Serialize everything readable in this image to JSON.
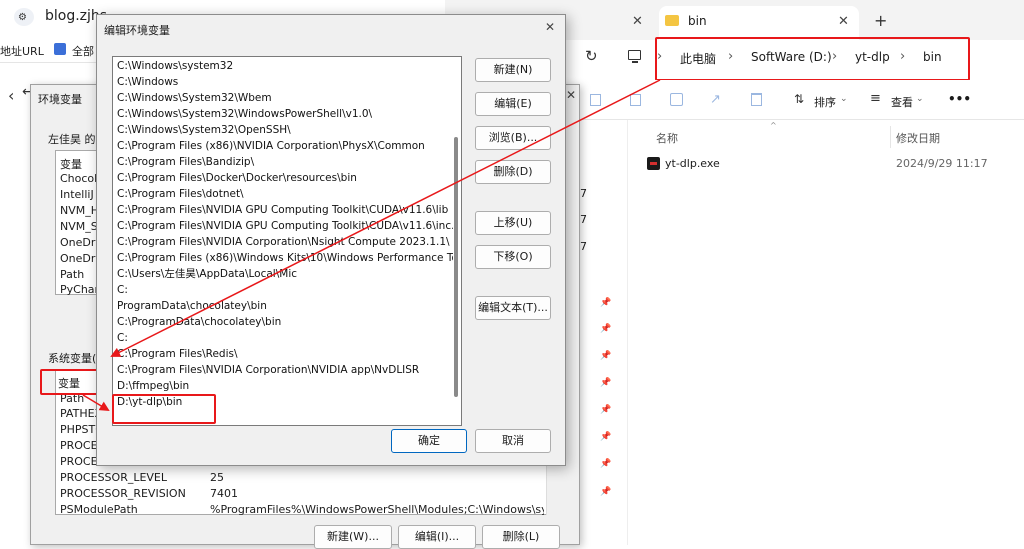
{
  "browser": {
    "tab_title": "blog.zjhs",
    "bookmark_1": "地址URL",
    "bookmark_2": "全部"
  },
  "explorer": {
    "tab_title": "bin",
    "breadcrumb": [
      "此电脑",
      "SoftWare (D:)",
      "yt-dlp",
      "bin"
    ],
    "toolbar": {
      "sort_label": "排序",
      "view_label": "查看",
      "more": "•••"
    },
    "columns": {
      "name": "名称",
      "date": "修改日期"
    },
    "files": [
      {
        "name": "yt-dlp.exe",
        "date": "2024/9/29 11:17"
      }
    ],
    "clipped_values": [
      "7",
      "7",
      "7"
    ]
  },
  "env_dialog": {
    "title": "环境变量",
    "user_section": "左佳昊 的用",
    "user_header": "变量",
    "user_vars": [
      "Chocola",
      "IntelliJ I",
      "NVM_H",
      "NVM_S",
      "OneDriv",
      "OneDriv",
      "Path",
      "PyCharr"
    ],
    "system_section": "系统变量(S)",
    "system_header": "变量",
    "system_vars": [
      {
        "name": "Path",
        "value": ""
      },
      {
        "name": "PATHEXT",
        "value": ""
      },
      {
        "name": "PHPSTORM",
        "value": ""
      },
      {
        "name": "PROCESSOR",
        "value": ""
      },
      {
        "name": "PROCESSOR",
        "value": ""
      },
      {
        "name": "PROCESSOR_LEVEL",
        "value": "25"
      },
      {
        "name": "PROCESSOR_REVISION",
        "value": "7401"
      },
      {
        "name": "PSModulePath",
        "value": "%ProgramFiles%\\WindowsPowerShell\\Modules;C:\\Windows\\syste"
      }
    ],
    "buttons": {
      "new": "新建(W)...",
      "edit": "编辑(I)...",
      "delete": "删除(L)"
    }
  },
  "edit_dialog": {
    "title": "编辑环境变量",
    "paths": [
      "C:\\Windows\\system32",
      "C:\\Windows",
      "C:\\Windows\\System32\\Wbem",
      "C:\\Windows\\System32\\WindowsPowerShell\\v1.0\\",
      "C:\\Windows\\System32\\OpenSSH\\",
      "C:\\Program Files (x86)\\NVIDIA Corporation\\PhysX\\Common",
      "C:\\Program Files\\Bandizip\\",
      "C:\\Program Files\\Docker\\Docker\\resources\\bin",
      "C:\\Program Files\\dotnet\\",
      "C:\\Program Files\\NVIDIA GPU Computing Toolkit\\CUDA\\v11.6\\lib",
      "C:\\Program Files\\NVIDIA GPU Computing Toolkit\\CUDA\\v11.6\\inc...",
      "C:\\Program Files\\NVIDIA Corporation\\Nsight Compute 2023.1.1\\",
      "C:\\Program Files (x86)\\Windows Kits\\10\\Windows Performance To...",
      "C:\\Users\\左佳昊\\AppData\\Local\\Mic",
      "C:",
      "ProgramData\\chocolatey\\bin",
      "C:\\ProgramData\\chocolatey\\bin",
      "C:",
      "C:\\Program Files\\Redis\\",
      "C:\\Program Files\\NVIDIA Corporation\\NVIDIA app\\NvDLISR",
      "D:\\ffmpeg\\bin",
      "D:\\yt-dlp\\bin"
    ],
    "buttons": {
      "new": "新建(N)",
      "edit": "编辑(E)",
      "browse": "浏览(B)...",
      "delete": "删除(D)",
      "move_up": "上移(U)",
      "move_down": "下移(O)",
      "edit_text": "编辑文本(T)...",
      "ok": "确定",
      "cancel": "取消"
    },
    "close": "✕"
  },
  "colors": {
    "highlight": "#e8181a",
    "accent": "#0067c0"
  }
}
